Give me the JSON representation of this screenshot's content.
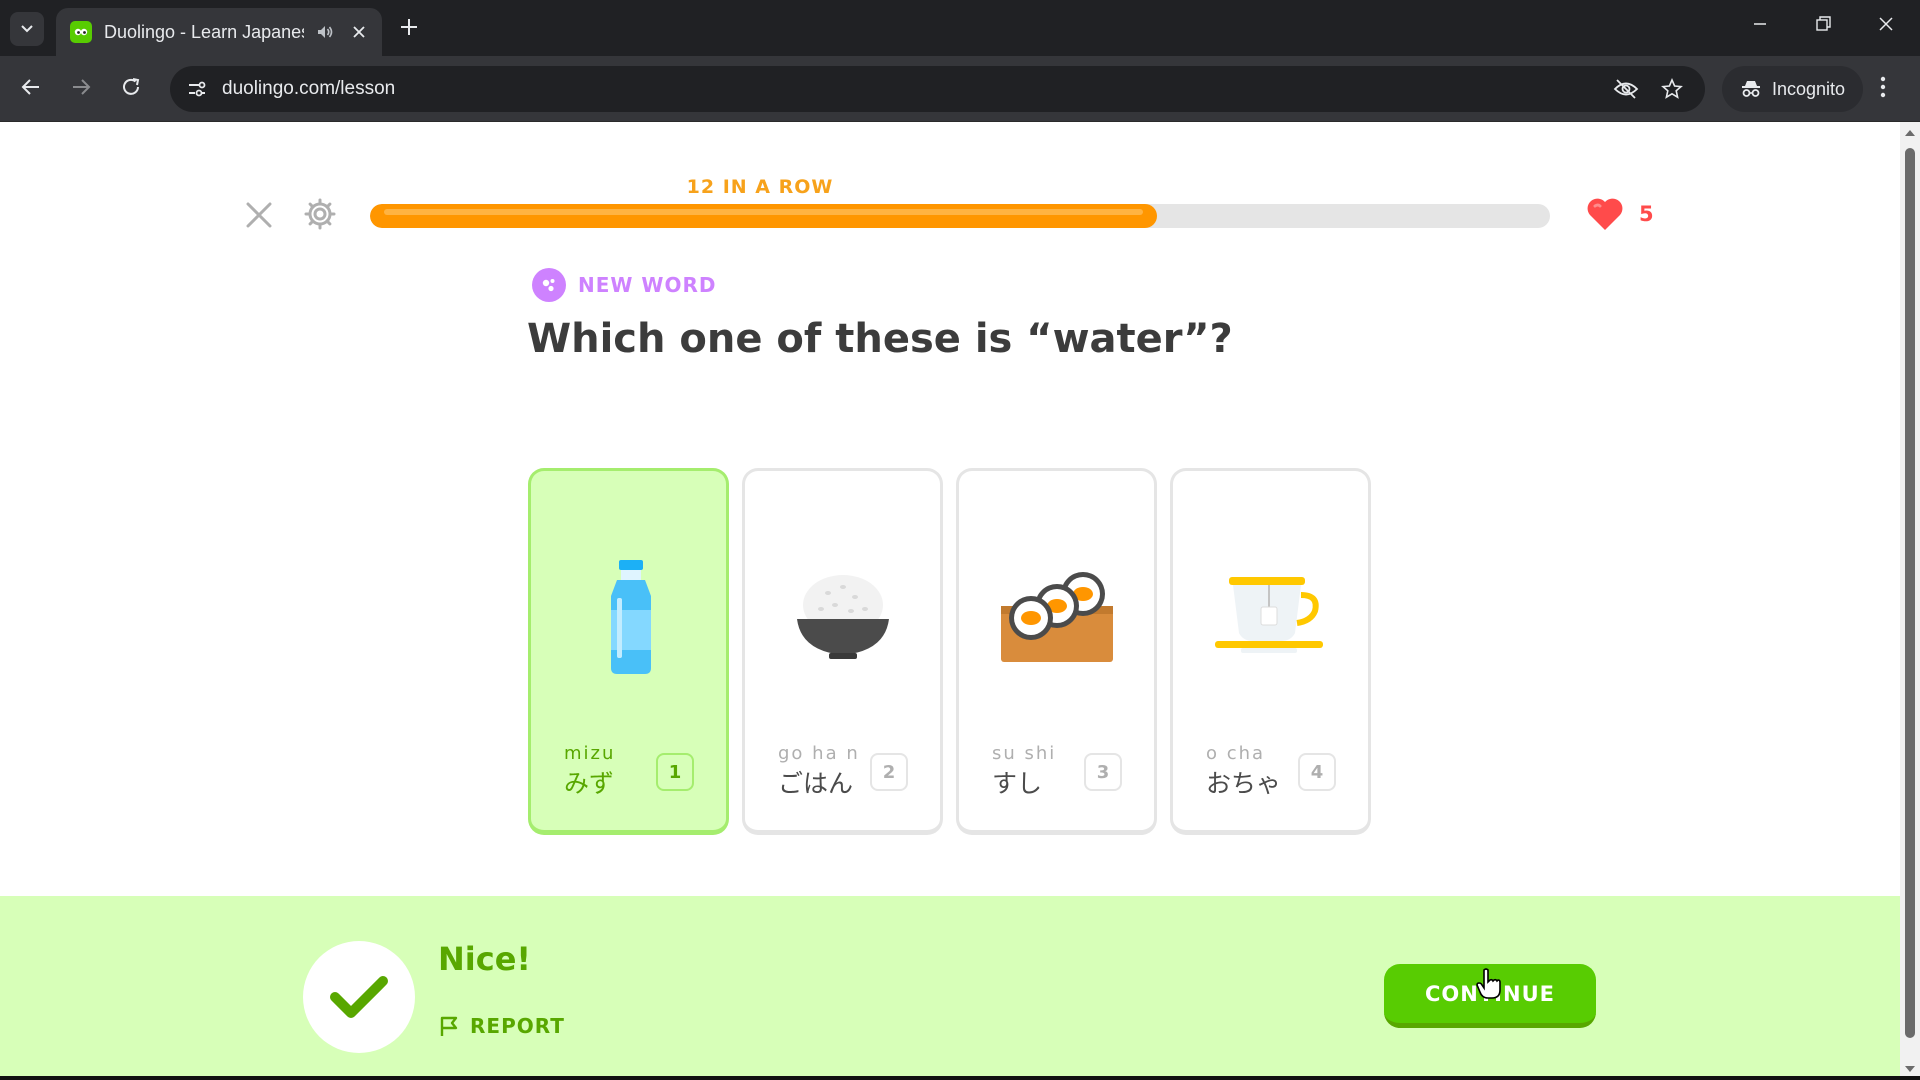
{
  "browser": {
    "tab_title": "Duolingo - Learn Japanese",
    "url": "duolingo.com/lesson",
    "incognito_label": "Incognito"
  },
  "lesson": {
    "streak_label": "12 IN A ROW",
    "progress_fraction": 0.667,
    "hearts": "5",
    "new_word_label": "NEW WORD",
    "question": "Which one of these is “water”?",
    "choices": [
      {
        "romaji": "mizu",
        "kana": "みず",
        "key": "1",
        "icon": "water-bottle-icon",
        "selected": true
      },
      {
        "romaji": "go ha n",
        "kana": "ごはん",
        "key": "2",
        "icon": "rice-bowl-icon",
        "selected": false
      },
      {
        "romaji": "su shi",
        "kana": "すし",
        "key": "3",
        "icon": "sushi-icon",
        "selected": false
      },
      {
        "romaji": "o  cha",
        "kana": "おちゃ",
        "key": "4",
        "icon": "tea-cup-icon",
        "selected": false
      }
    ]
  },
  "feedback": {
    "title": "Nice!",
    "report_label": "REPORT",
    "continue_label": "CONTINUE"
  },
  "colors": {
    "brand_green": "#58cc02",
    "progress_orange": "#ff9600",
    "heart_red": "#ff4b4b",
    "new_word_purple": "#ce82ff",
    "feedback_bg": "#d7ffb8"
  }
}
